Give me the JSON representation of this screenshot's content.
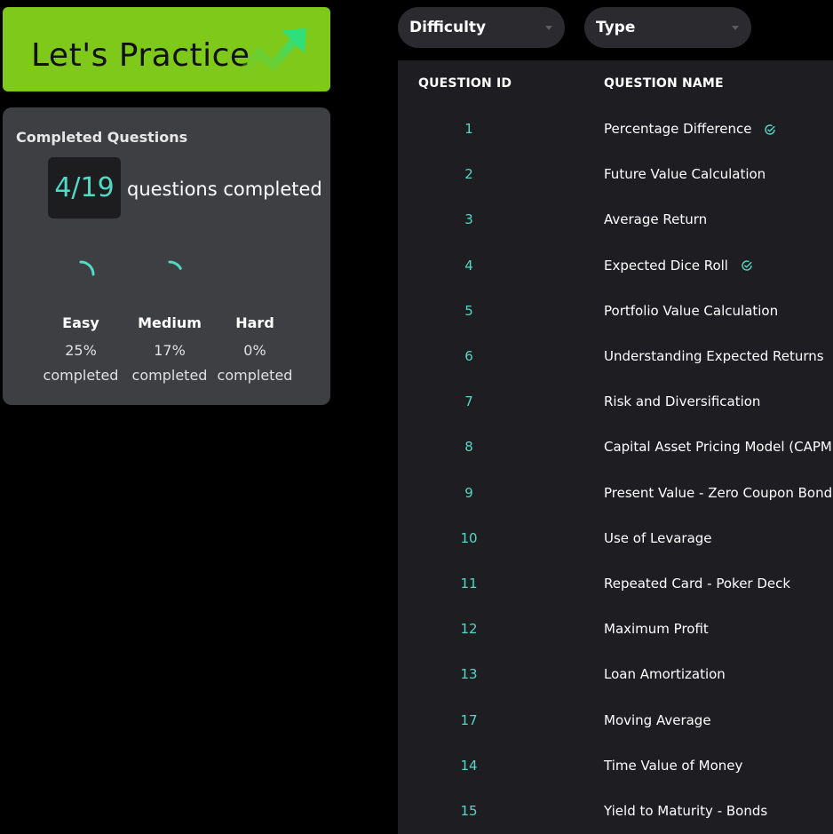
{
  "banner": {
    "title": "Let's Practice",
    "accent": "#7fc91b",
    "icon": "trending-up-icon"
  },
  "progress": {
    "heading": "Completed Questions",
    "count": "4/19",
    "count_label": "questions completed",
    "accent": "#52d8c4",
    "levels": [
      {
        "name": "Easy",
        "percent": "25%",
        "label": "completed",
        "fraction": 0.25
      },
      {
        "name": "Medium",
        "percent": "17%",
        "label": "completed",
        "fraction": 0.17
      },
      {
        "name": "Hard",
        "percent": "0%",
        "label": "completed",
        "fraction": 0
      }
    ]
  },
  "filters": {
    "difficulty": {
      "label": "Difficulty"
    },
    "type": {
      "label": "Type"
    }
  },
  "table": {
    "headers": {
      "id": "QUESTION ID",
      "name": "QUESTION NAME"
    },
    "rows": [
      {
        "id": "1",
        "name": "Percentage Difference",
        "completed": true
      },
      {
        "id": "2",
        "name": "Future Value Calculation",
        "completed": false
      },
      {
        "id": "3",
        "name": "Average Return",
        "completed": false
      },
      {
        "id": "4",
        "name": "Expected Dice Roll",
        "completed": true
      },
      {
        "id": "5",
        "name": "Portfolio Value Calculation",
        "completed": false
      },
      {
        "id": "6",
        "name": "Understanding Expected Returns",
        "completed": true
      },
      {
        "id": "7",
        "name": "Risk and Diversification",
        "completed": false
      },
      {
        "id": "8",
        "name": "Capital Asset Pricing Model (CAPM)",
        "completed": true
      },
      {
        "id": "9",
        "name": "Present Value - Zero Coupon Bond",
        "completed": false
      },
      {
        "id": "10",
        "name": "Use of Levarage",
        "completed": false
      },
      {
        "id": "11",
        "name": "Repeated Card - Poker Deck",
        "completed": false
      },
      {
        "id": "12",
        "name": "Maximum Profit",
        "completed": false
      },
      {
        "id": "13",
        "name": "Loan Amortization",
        "completed": false
      },
      {
        "id": "17",
        "name": "Moving Average",
        "completed": false
      },
      {
        "id": "14",
        "name": "Time Value of Money",
        "completed": false
      },
      {
        "id": "15",
        "name": "Yield to Maturity - Bonds",
        "completed": false
      }
    ]
  }
}
